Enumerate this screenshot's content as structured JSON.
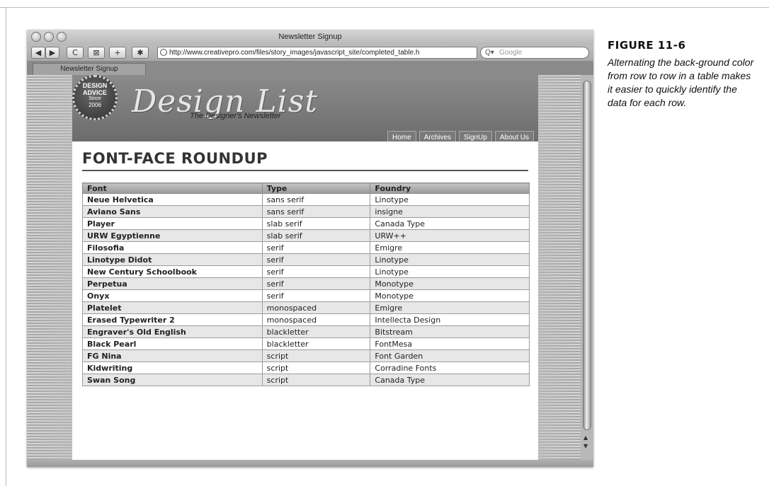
{
  "figure": {
    "number": "FIGURE 11-6",
    "caption": "Alternating the back-ground color from row to row in a table makes it easier to quickly identify the data for each row."
  },
  "window": {
    "title": "Newsletter Signup",
    "tab_label": "Newsletter Signup",
    "url": "http://www.creativepro.com/files/story_images/javascript_site/completed_table.h",
    "search_placeholder": "Google",
    "toolbar": {
      "back_label": "◀",
      "forward_label": "▶",
      "reload_label": "C",
      "snapback_label": "⊠",
      "add_bookmark_label": "+",
      "bug_label": "✱"
    }
  },
  "site": {
    "badge": {
      "line1": "DESIGN",
      "line2": "ADVICE",
      "line3": "Since",
      "line4": "2006"
    },
    "logo": "Design List",
    "tagline": "The Designer's Newsletter",
    "nav": [
      "Home",
      "Archives",
      "SignUp",
      "About Us"
    ]
  },
  "page": {
    "heading": "FONT-FACE ROUNDUP",
    "table": {
      "headers": [
        "Font",
        "Type",
        "Foundry"
      ],
      "rows": [
        [
          "Neue Helvetica",
          "sans serif",
          "Linotype"
        ],
        [
          "Aviano Sans",
          "sans serif",
          "insigne"
        ],
        [
          "Player",
          "slab serif",
          "Canada Type"
        ],
        [
          "URW Egyptienne",
          "slab serif",
          "URW++"
        ],
        [
          "Filosofia",
          "serif",
          "Emigre"
        ],
        [
          "Linotype Didot",
          "serif",
          "Linotype"
        ],
        [
          "New Century Schoolbook",
          "serif",
          "Linotype"
        ],
        [
          "Perpetua",
          "serif",
          "Monotype"
        ],
        [
          "Onyx",
          "serif",
          "Monotype"
        ],
        [
          "Platelet",
          "monospaced",
          "Emigre"
        ],
        [
          "Erased Typewriter 2",
          "monospaced",
          "Intellecta Design"
        ],
        [
          "Engraver's Old English",
          "blackletter",
          "Bitstream"
        ],
        [
          "Black Pearl",
          "blackletter",
          "FontMesa"
        ],
        [
          "FG Nina",
          "script",
          "Font Garden"
        ],
        [
          "Kidwriting",
          "script",
          "Corradine Fonts"
        ],
        [
          "Swan Song",
          "script",
          "Canada Type"
        ]
      ]
    }
  },
  "colors": {
    "row_even": "#ffffff",
    "row_odd": "#e7e7e7",
    "header_bg": "#9a9a9a",
    "masthead_bg": "#7a7a7a"
  }
}
